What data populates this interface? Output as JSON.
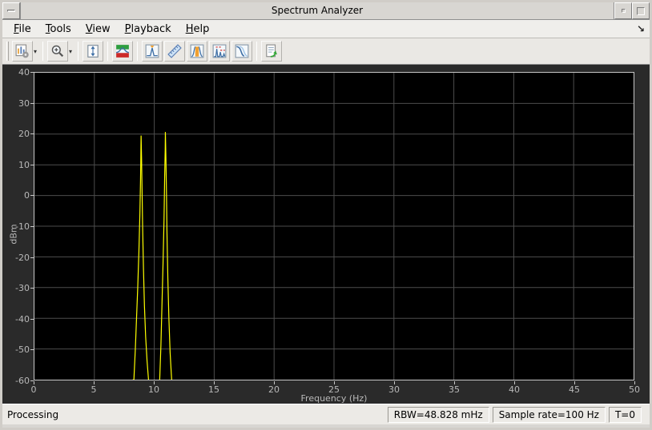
{
  "window": {
    "title": "Spectrum Analyzer",
    "controls": {
      "window_menu_icon": "dash-glyph",
      "minimize_icon": "small-square-glyph",
      "maximize_icon": "square-glyph"
    }
  },
  "menu_bar": {
    "items": [
      {
        "label": "File",
        "mnemonic": "F",
        "rest": "ile"
      },
      {
        "label": "Tools",
        "mnemonic": "T",
        "rest": "ools"
      },
      {
        "label": "View",
        "mnemonic": "V",
        "rest": "iew"
      },
      {
        "label": "Playback",
        "mnemonic": "P",
        "rest": "layback"
      },
      {
        "label": "Help",
        "mnemonic": "H",
        "rest": "elp"
      }
    ],
    "dock_arrow_glyph": "↘"
  },
  "toolbar": {
    "groups": [
      [
        {
          "name": "configuration-properties",
          "dropdown": true
        }
      ],
      [
        {
          "name": "zoom-in",
          "dropdown": true
        }
      ],
      [
        {
          "name": "scale-y-axis",
          "dropdown": false
        }
      ],
      [
        {
          "name": "spectrum-settings",
          "dropdown": false
        }
      ],
      [
        {
          "name": "peak-finder",
          "dropdown": false
        },
        {
          "name": "cursor-measurements",
          "dropdown": false
        },
        {
          "name": "channel-measurements",
          "dropdown": false
        },
        {
          "name": "distortion-measurements",
          "dropdown": false
        },
        {
          "name": "ccdf-measurements",
          "dropdown": false
        }
      ],
      [
        {
          "name": "reduce-plot-rate",
          "dropdown": false
        }
      ]
    ]
  },
  "chart_data": {
    "type": "line",
    "title": "",
    "xlabel": "Frequency (Hz)",
    "ylabel": "dBm",
    "xlim": [
      0,
      50
    ],
    "ylim": [
      -60,
      40
    ],
    "xticks": [
      0,
      5,
      10,
      15,
      20,
      25,
      30,
      35,
      40,
      45,
      50
    ],
    "yticks": [
      40,
      30,
      20,
      10,
      0,
      -10,
      -20,
      -30,
      -40,
      -50,
      -60
    ],
    "grid": true,
    "plot_background": "#000000",
    "figure_background": "#2a2a2a",
    "grid_color": "#4d4d4d",
    "trace_color": "#ffff00",
    "peaks": [
      {
        "freq_hz": 9,
        "level_dbm": 19.5
      },
      {
        "freq_hz": 11,
        "level_dbm": 20.7
      }
    ],
    "series": [
      {
        "name": "spectrum-trace",
        "color": "#ffff00",
        "points": [
          [
            0.0,
            -70
          ],
          [
            8.3,
            -60
          ],
          [
            8.42,
            -50
          ],
          [
            8.52,
            -40
          ],
          [
            8.62,
            -30
          ],
          [
            8.72,
            -18
          ],
          [
            8.8,
            -6
          ],
          [
            8.85,
            5
          ],
          [
            8.88,
            13
          ],
          [
            8.9,
            19.5
          ],
          [
            8.94,
            12
          ],
          [
            8.98,
            2
          ],
          [
            9.03,
            -10
          ],
          [
            9.1,
            -24
          ],
          [
            9.18,
            -36
          ],
          [
            9.28,
            -46
          ],
          [
            9.4,
            -54
          ],
          [
            9.52,
            -60
          ],
          [
            9.6,
            -65
          ],
          [
            10.35,
            -65
          ],
          [
            10.45,
            -60
          ],
          [
            10.55,
            -49
          ],
          [
            10.64,
            -36
          ],
          [
            10.73,
            -22
          ],
          [
            10.81,
            -8
          ],
          [
            10.87,
            6
          ],
          [
            10.91,
            15
          ],
          [
            10.93,
            20.7
          ],
          [
            10.97,
            12
          ],
          [
            11.01,
            2
          ],
          [
            11.06,
            -12
          ],
          [
            11.13,
            -27
          ],
          [
            11.22,
            -40
          ],
          [
            11.32,
            -51
          ],
          [
            11.42,
            -58
          ],
          [
            11.5,
            -63
          ],
          [
            50.0,
            -70
          ]
        ]
      }
    ]
  },
  "status_bar": {
    "left": "Processing",
    "fields": [
      "RBW=48.828 mHz",
      "Sample rate=100 Hz",
      "T=0"
    ]
  }
}
